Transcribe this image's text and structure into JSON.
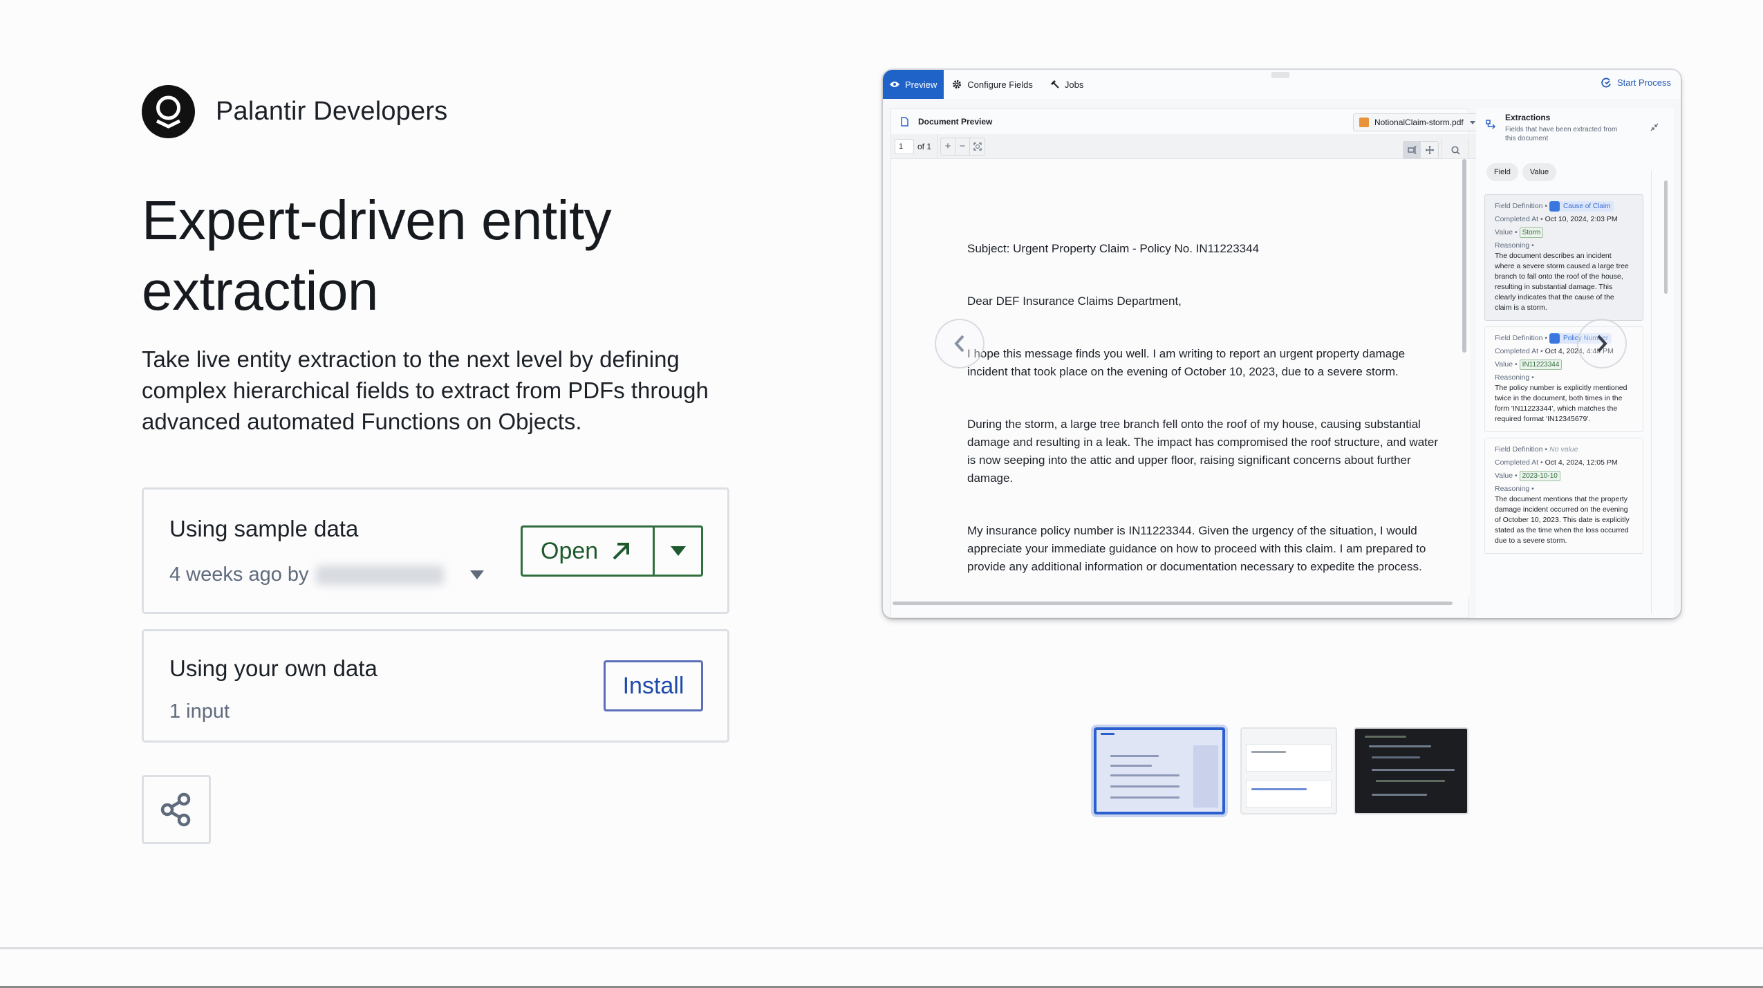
{
  "brand": {
    "name": "Palantir Developers",
    "logo_icon": "palantir-logo"
  },
  "hero": {
    "title": "Expert-driven entity extraction",
    "description": "Take live entity extraction to the next level by defining complex hierarchical fields to extract from PDFs through advanced automated Functions on Objects."
  },
  "cards": {
    "sample": {
      "title": "Using sample data",
      "subtitle": "4 weeks ago by",
      "author_redacted": true,
      "open_label": "Open",
      "open_icon": "arrow-up-right-icon",
      "menu_icon": "caret-down-icon"
    },
    "own": {
      "title": "Using your own data",
      "subtitle": "1 input",
      "install_label": "Install"
    }
  },
  "share": {
    "icon": "share-icon"
  },
  "preview": {
    "tabs": [
      {
        "label": "Preview",
        "icon": "eye-icon",
        "active": true
      },
      {
        "label": "Configure Fields",
        "icon": "gear-icon",
        "active": false
      },
      {
        "label": "Jobs",
        "icon": "hammer-icon",
        "active": false
      }
    ],
    "start_process_label": "Start Process",
    "document_preview": {
      "title": "Document Preview",
      "file_name": "NotionalClaim-storm.pdf",
      "page_current": "1",
      "page_total_label": "of 1",
      "paragraphs": [
        "Subject: Urgent Property Claim - Policy No. IN11223344",
        "Dear DEF Insurance Claims Department,",
        "I hope this message finds you well. I am writing to report an urgent property damage incident that took place on the evening of October 10, 2023, due to a severe storm.",
        "During the storm, a large tree branch fell onto the roof of my house, causing substantial damage and resulting in a leak. The impact has compromised the roof structure, and water is now seeping into the attic and upper floor, raising significant concerns about further damage.",
        "My insurance policy number is IN11223344. Given the urgency of the situation, I would appreciate your immediate guidance on how to proceed with this claim. I am prepared to provide any additional information or documentation necessary to expedite the process."
      ]
    },
    "extractions": {
      "title": "Extractions",
      "subtitle": "Fields that have been extracted from this document",
      "pills": [
        "Field",
        "Value"
      ],
      "labels": {
        "field_definition": "Field Definition •",
        "completed_at": "Completed At •",
        "value": "Value •",
        "reasoning": "Reasoning •"
      },
      "items": [
        {
          "field": "Cause of Claim",
          "completed_at": "Oct 10, 2024, 2:03 PM",
          "value": "Storm",
          "reasoning": "The document describes an incident where a severe storm caused a large tree branch to fall onto the roof of the house, resulting in substantial damage. This clearly indicates that the cause of the claim is a storm."
        },
        {
          "field": "Policy Number",
          "completed_at": "Oct 4, 2024, 4:48 PM",
          "value": "IN11223344",
          "reasoning": "The policy number is explicitly mentioned twice in the document, both times in the form 'IN11223344', which matches the required format 'IN12345679'."
        },
        {
          "field": "No value",
          "completed_at": "Oct 4, 2024, 12:05 PM",
          "value": "2023-10-10",
          "reasoning": "The document mentions that the property damage incident occurred on the evening of October 10, 2023. This date is explicitly stated as the time when the loss occurred due to a severe storm."
        }
      ]
    }
  },
  "carousel": {
    "prev_icon": "chevron-left-icon",
    "next_icon": "chevron-right-icon",
    "thumbnails": [
      {
        "name": "document-preview-thumbnail",
        "selected": true
      },
      {
        "name": "automation-thumbnail",
        "selected": false
      },
      {
        "name": "code-thumbnail",
        "selected": false
      }
    ]
  },
  "colors": {
    "accent_blue": "#1f63c9",
    "open_green": "#2f6e3d",
    "install_blue": "#1f4aa8",
    "value_green": "#2f6e3d"
  }
}
